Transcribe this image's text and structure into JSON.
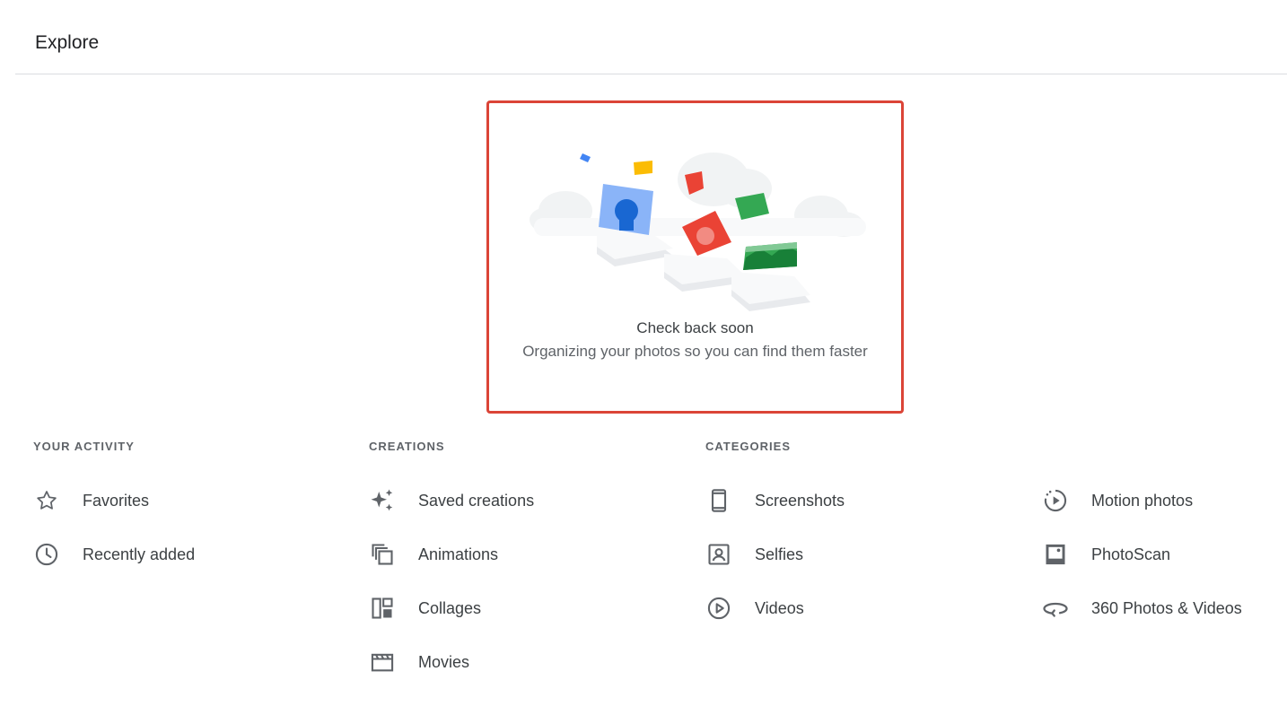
{
  "header": {
    "title": "Explore"
  },
  "empty_state": {
    "title": "Check back soon",
    "subtitle": "Organizing your photos so you can find them faster"
  },
  "sections": {
    "activity": {
      "heading": "YOUR ACTIVITY",
      "items": [
        {
          "label": "Favorites",
          "icon": "star-icon"
        },
        {
          "label": "Recently added",
          "icon": "clock-icon"
        }
      ]
    },
    "creations": {
      "heading": "CREATIONS",
      "items": [
        {
          "label": "Saved creations",
          "icon": "sparkle-icon"
        },
        {
          "label": "Animations",
          "icon": "animation-icon"
        },
        {
          "label": "Collages",
          "icon": "collage-icon"
        },
        {
          "label": "Movies",
          "icon": "movie-icon"
        }
      ]
    },
    "categories": {
      "heading": "CATEGORIES",
      "items": [
        {
          "label": "Screenshots",
          "icon": "phone-icon"
        },
        {
          "label": "Selfies",
          "icon": "portrait-icon"
        },
        {
          "label": "Videos",
          "icon": "play-circle-icon"
        }
      ]
    },
    "more": {
      "items": [
        {
          "label": "Motion photos",
          "icon": "motion-photo-icon"
        },
        {
          "label": "PhotoScan",
          "icon": "photoscan-icon"
        },
        {
          "label": "360 Photos & Videos",
          "icon": "rotate-360-icon"
        }
      ]
    }
  },
  "colors": {
    "highlight_border": "#db4437",
    "icon": "#5f6368",
    "text": "#3c4043"
  }
}
